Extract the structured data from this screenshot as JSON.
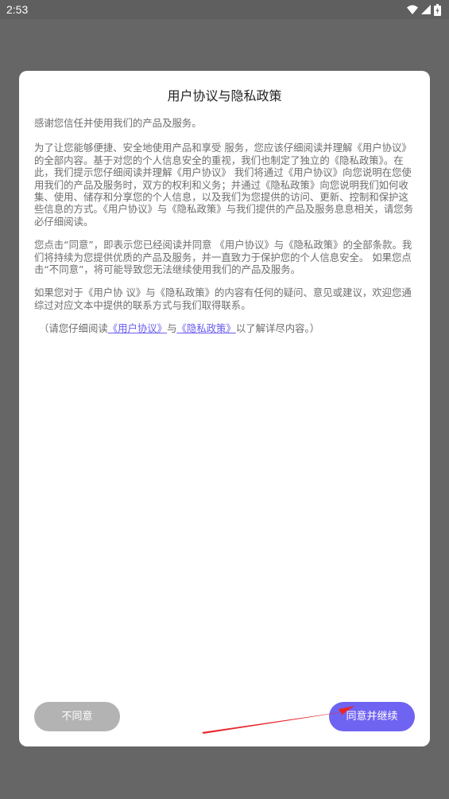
{
  "status_bar": {
    "time": "2:53",
    "icons": [
      "wifi-icon",
      "cell-signal-icon",
      "battery-icon"
    ]
  },
  "dialog": {
    "title": "用户协议与隐私政策",
    "paragraphs": [
      "感谢您信任并使用我们的产品及服务。",
      "为了让您能够便捷、安全地使用产品和享受 服务，您应该仔细阅读并理解《用户协议》的全部内容。基于对您的个人信息安全的重视，我们也制定了独立的《隐私政策》。在此，我们提示您仔细阅读并理解《用户协议》 我们将通过《用户协议》向您说明在您使用我们的产品及服务时，双方的权利和义务；并通过《隐私政策》向您说明我们如何收集、使用、储存和分享您的个人信息，以及我们为您提供的访问、更新、控制和保护这些信息的方式。《用户协议》与《隐私政策》与我们提供的产品及服务息息相关，请您务必仔细阅读。",
      "您点击“同意”，即表示您已经阅读并同意 《用户协议》与《隐私政策》的全部条款。我们将持续为您提供优质的产品及服务，并一直致力于保护您的个人信息安全。 如果您点击“不同意”，将可能导致您无法继续使用我们的产品及服务。",
      "如果您对于《用户协 议》与《隐私政策》的内容有任何的疑问、意见或建议，欢迎您通综过对应文本中提供的联系方式与我们取得联系。"
    ],
    "hint": {
      "prefix": "（请您仔细阅读",
      "link1": "《用户协议》",
      "middle": "与",
      "link2": "《隐私政策》",
      "suffix": "以了解详尽内容。）"
    },
    "buttons": {
      "disagree": "不同意",
      "agree": "同意并继续"
    }
  },
  "colors": {
    "overlay": "#666666",
    "accent": "#6f63f2",
    "link": "#6a5cf0",
    "disabled_button": "#b3b3b3",
    "annotation_arrow": "#e8262b"
  }
}
